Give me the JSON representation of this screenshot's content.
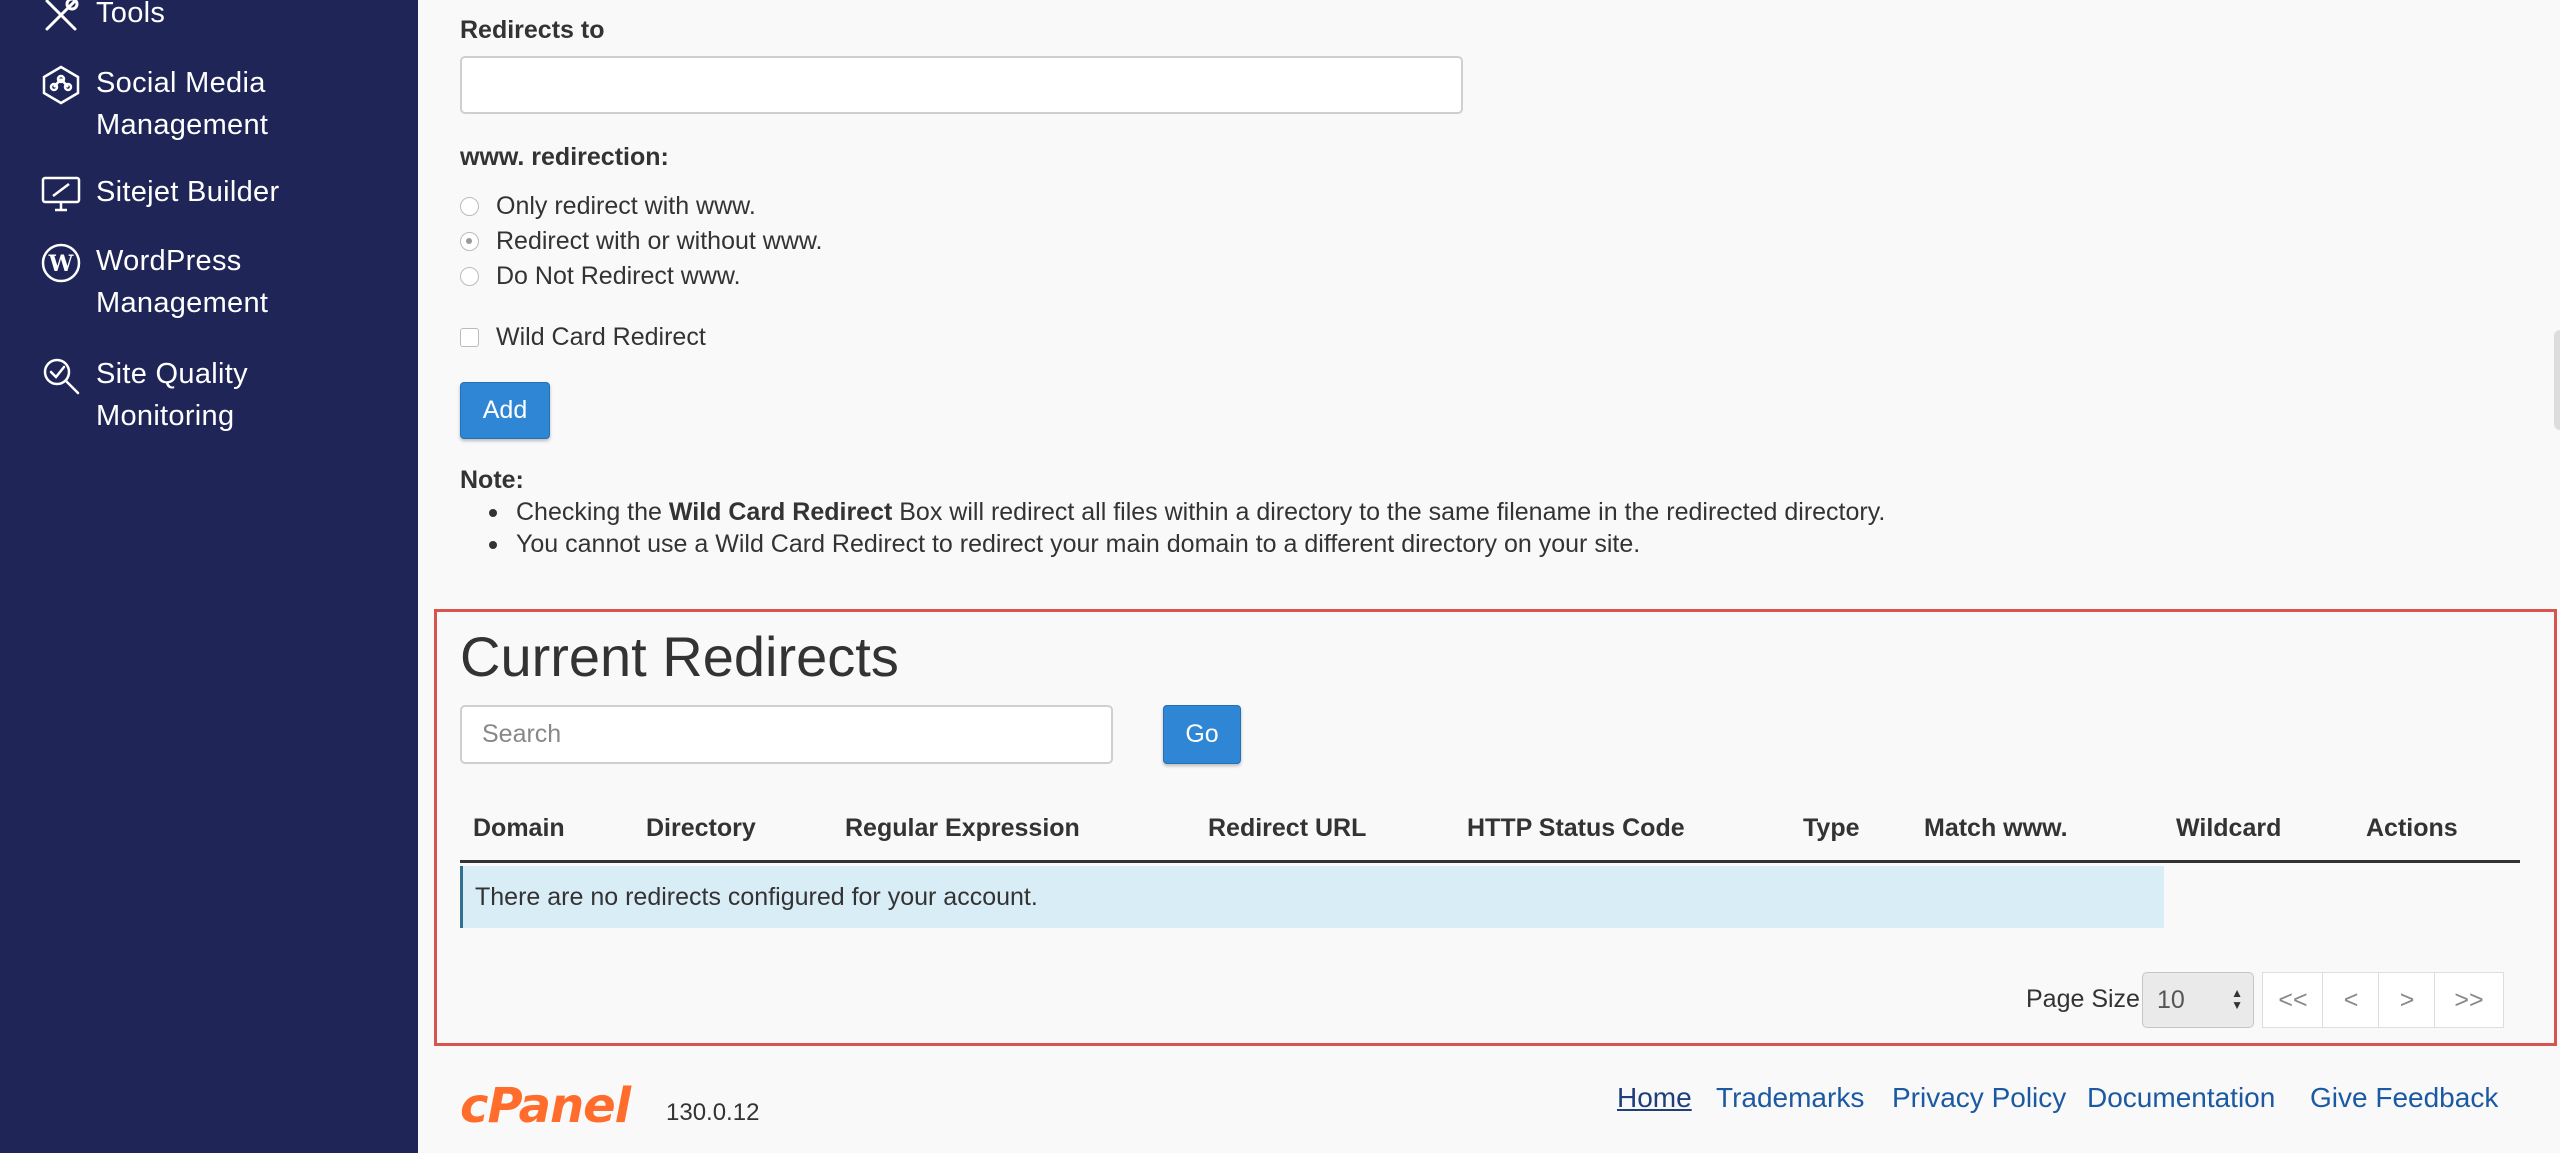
{
  "sidebar": {
    "items": [
      {
        "label_lines": [
          "Tools"
        ],
        "icon": "tools-icon"
      },
      {
        "label_lines": [
          "Social Media",
          "Management"
        ],
        "icon": "social-media-icon"
      },
      {
        "label_lines": [
          "Sitejet Builder"
        ],
        "icon": "sitejet-icon"
      },
      {
        "label_lines": [
          "WordPress",
          "Management"
        ],
        "icon": "wordpress-icon"
      },
      {
        "label_lines": [
          "Site Quality",
          "Monitoring"
        ],
        "icon": "site-quality-icon"
      }
    ]
  },
  "form": {
    "redirects_to_label": "Redirects to",
    "redirects_to_value": "",
    "www_label": "www. redirection:",
    "www_options": [
      {
        "label": "Only redirect with www.",
        "checked": false
      },
      {
        "label": "Redirect with or without www.",
        "checked": true
      },
      {
        "label": "Do Not Redirect www.",
        "checked": false
      }
    ],
    "wildcard_label": "Wild Card Redirect",
    "add_button": "Add"
  },
  "note": {
    "title": "Note:",
    "item1_prefix": "Checking the ",
    "item1_bold": "Wild Card Redirect",
    "item1_suffix": " Box will redirect all files within a directory to the same filename in the redirected directory.",
    "item2": "You cannot use a Wild Card Redirect to redirect your main domain to a different directory on your site."
  },
  "current": {
    "title": "Current Redirects",
    "search_placeholder": "Search",
    "go_button": "Go",
    "columns": [
      "Domain",
      "Directory",
      "Regular Expression",
      "Redirect URL",
      "HTTP Status Code",
      "Type",
      "Match www.",
      "Wildcard",
      "Actions"
    ],
    "empty_message": "There are no redirects configured for your account.",
    "page_size_label": "Page Size",
    "page_size_value": "10",
    "pager": [
      "<<",
      "<",
      ">",
      ">>"
    ]
  },
  "footer": {
    "logo": "cPanel",
    "version": "130.0.12",
    "links": [
      "Home",
      "Trademarks",
      "Privacy Policy",
      "Documentation",
      "Give Feedback"
    ]
  },
  "colors": {
    "sidebar_bg": "#1f2557",
    "primary": "#2f86d4",
    "highlight_border": "#d9534f",
    "empty_row_bg": "#d9edf7",
    "logo": "#ff6c2c"
  }
}
